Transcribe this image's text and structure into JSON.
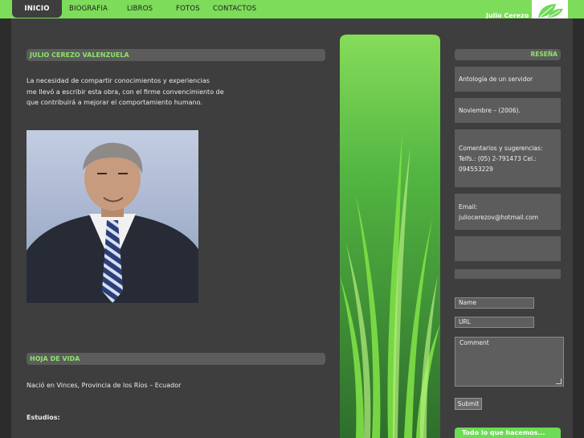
{
  "nav": {
    "items": [
      "INICIO",
      "BIOGRAFIA",
      "LIBROS",
      "FOTOS",
      "CONTACTOS"
    ],
    "active": "INICIO"
  },
  "brand": {
    "name": "Julio Cerezo",
    "logo_icon": "leaf-icon",
    "logo_color": "#6ddb55"
  },
  "colors": {
    "accent": "#7ddc5a",
    "heading": "#8ee36a",
    "panel": "#3e3e3e",
    "bar": "#5c5c5c"
  },
  "main": {
    "intro_title": "JULIO CEREZO VALENZUELA",
    "intro_lines": [
      "La necesidad de compartir conocimientos y experiencias",
      "me llevó a escribir esta obra, con el firme convencimiento de",
      "que contribuirá a mejorar el comportamiento humano."
    ],
    "cv_title": "HOJA DE VIDA",
    "cv_line": "Nació en Vinces, Provincia de los Ríos – Ecuador",
    "studies_label": "Estudios:"
  },
  "sidebar": {
    "heading": "RESEÑA",
    "boxes": [
      [
        "Antología de un servidor"
      ],
      [
        "Noviembre – (2006)."
      ],
      [
        "Comentarios y sugerencias:",
        "Telfs.: (05) 2-791473 Cel.:",
        "094553229"
      ],
      [
        "Email:",
        "juliocerezov@hotmail.com"
      ],
      [],
      []
    ]
  },
  "form": {
    "name_placeholder": "Name",
    "url_placeholder": "URL",
    "comment_placeholder": "Comment",
    "submit_label": "Submit"
  },
  "footer_box": {
    "text": "Todo lo que hacemos..."
  }
}
